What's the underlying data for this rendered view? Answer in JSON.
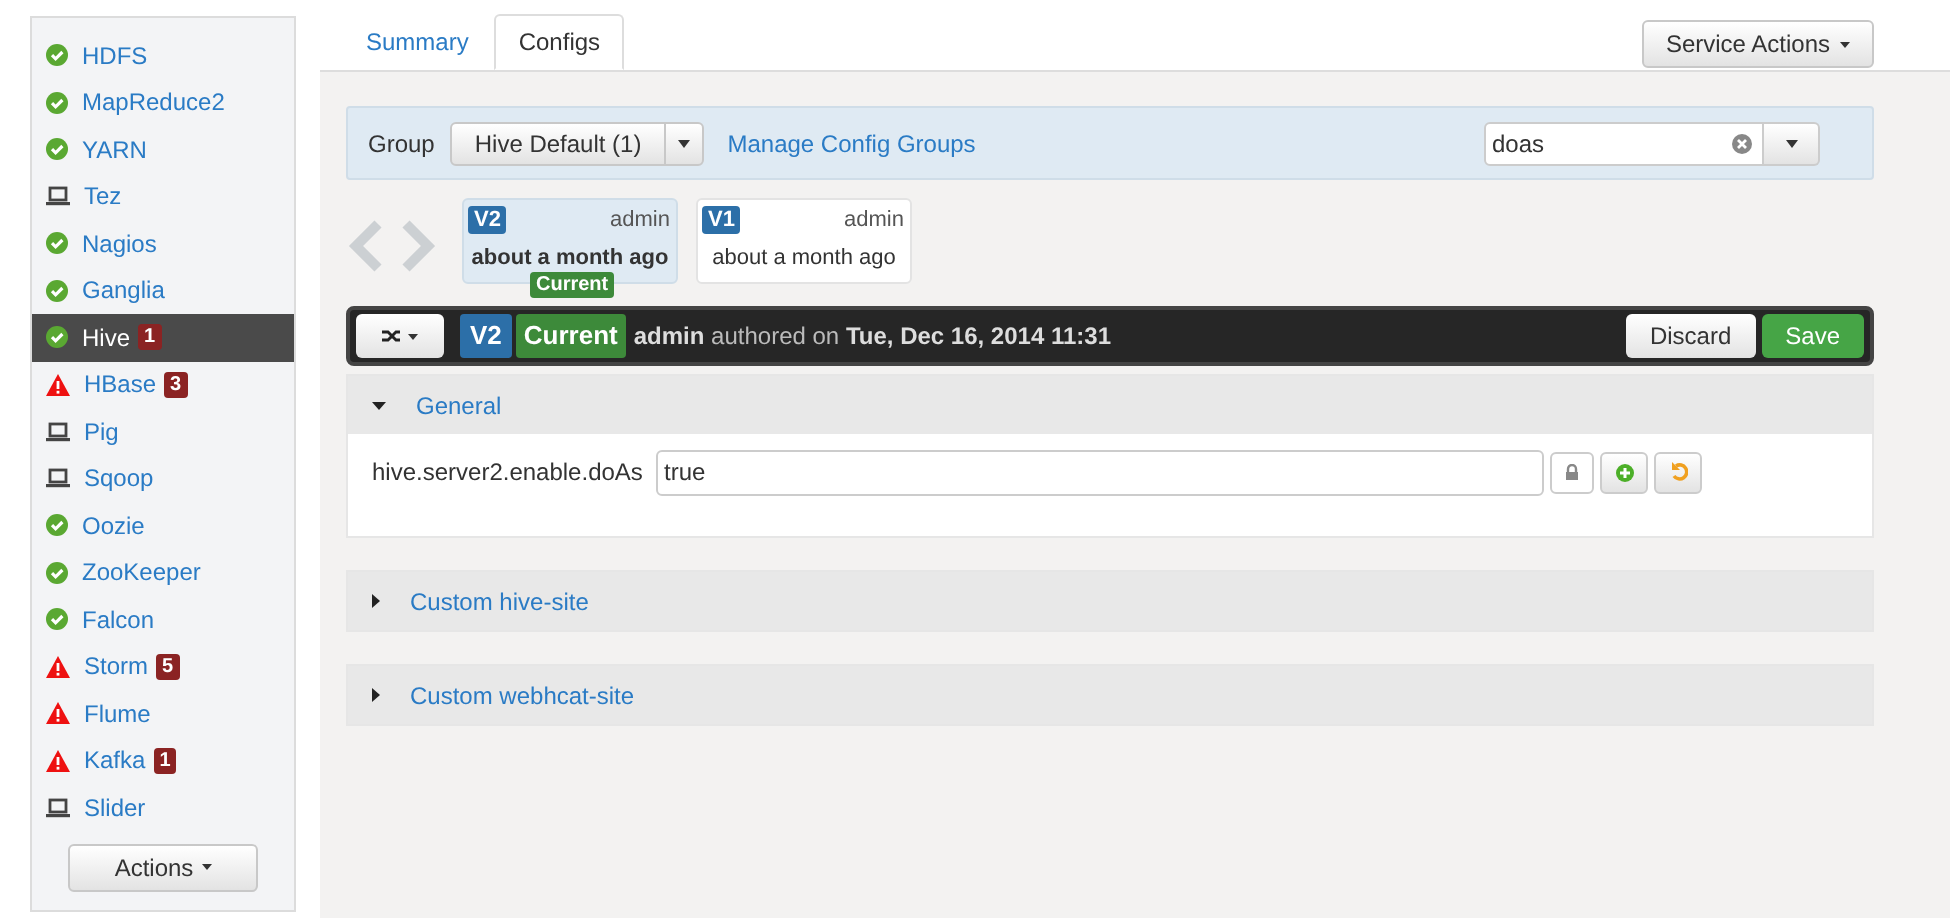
{
  "sidebar": {
    "items": [
      {
        "label": "HDFS",
        "kind": "ok",
        "selected": false
      },
      {
        "label": "MapReduce2",
        "kind": "ok",
        "selected": false
      },
      {
        "label": "YARN",
        "kind": "ok",
        "selected": false
      },
      {
        "label": "Tez",
        "kind": "client",
        "selected": false
      },
      {
        "label": "Nagios",
        "kind": "ok",
        "selected": false
      },
      {
        "label": "Ganglia",
        "kind": "ok",
        "selected": false
      },
      {
        "label": "Hive",
        "kind": "ok",
        "selected": true,
        "badge": "1"
      },
      {
        "label": "HBase",
        "kind": "alert",
        "selected": false,
        "badge": "3"
      },
      {
        "label": "Pig",
        "kind": "client",
        "selected": false
      },
      {
        "label": "Sqoop",
        "kind": "client",
        "selected": false
      },
      {
        "label": "Oozie",
        "kind": "ok",
        "selected": false
      },
      {
        "label": "ZooKeeper",
        "kind": "ok",
        "selected": false
      },
      {
        "label": "Falcon",
        "kind": "ok",
        "selected": false
      },
      {
        "label": "Storm",
        "kind": "alert",
        "selected": false,
        "badge": "5"
      },
      {
        "label": "Flume",
        "kind": "alert",
        "selected": false
      },
      {
        "label": "Kafka",
        "kind": "alert",
        "selected": false,
        "badge": "1"
      },
      {
        "label": "Slider",
        "kind": "client",
        "selected": false
      }
    ],
    "actions_button": "Actions"
  },
  "tabs": [
    {
      "label": "Summary",
      "selected": false
    },
    {
      "label": "Configs",
      "selected": true
    }
  ],
  "service_actions": "Service Actions",
  "group_bar": {
    "label": "Group",
    "group": "Hive Default (1)",
    "manage_link": "Manage Config Groups",
    "filter_value": "doas"
  },
  "versions": [
    {
      "version": "V2",
      "author": "admin",
      "time": "about a month ago",
      "selected": true,
      "current_label": "Current"
    },
    {
      "version": "V1",
      "author": "admin",
      "time": "about a month ago",
      "selected": false
    }
  ],
  "version_bar": {
    "version": "V2",
    "current_label": "Current",
    "author": "admin",
    "authored_text": "authored on",
    "date": "Tue, Dec 16, 2014 11:31",
    "discard": "Discard",
    "save": "Save"
  },
  "sections": [
    {
      "title": "General",
      "expanded": true,
      "properties": [
        {
          "name": "hive.server2.enable.doAs",
          "value": "true"
        }
      ]
    },
    {
      "title": "Custom hive-site",
      "expanded": false
    },
    {
      "title": "Custom webhcat-site",
      "expanded": false
    }
  ]
}
